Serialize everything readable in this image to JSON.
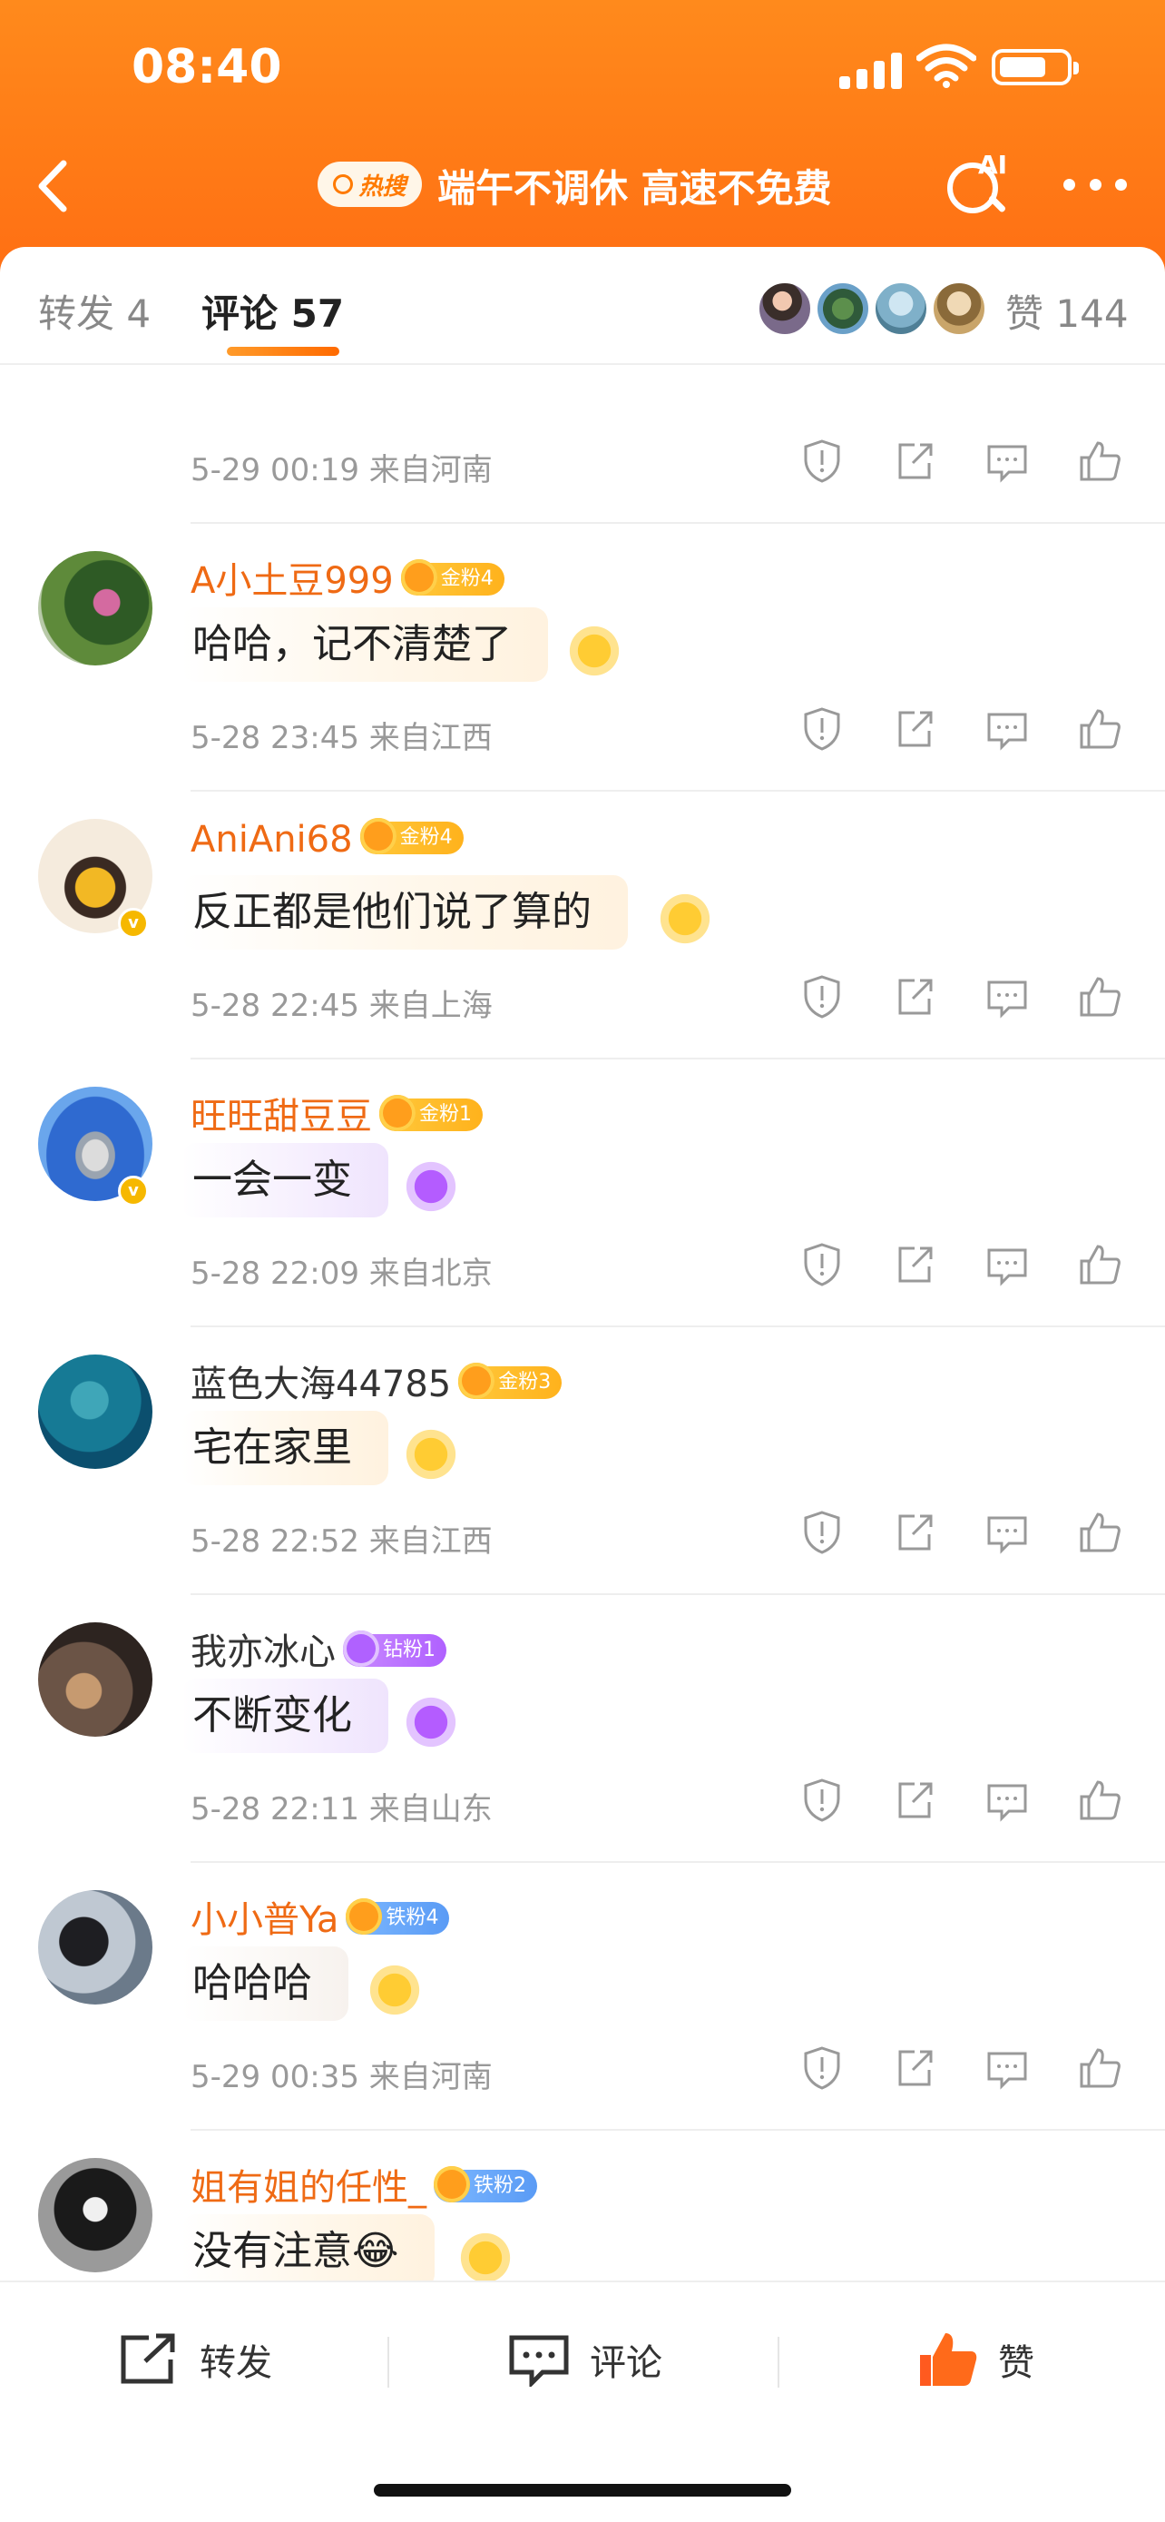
{
  "status_bar": {
    "time": "08:40"
  },
  "nav": {
    "hot_badge": "热搜",
    "title": "端午不调休 高速不免费",
    "ai_label": "AI"
  },
  "tabs": {
    "repost": "转发 4",
    "comments": "评论 57",
    "likes_prefix": "赞",
    "likes_count": "144"
  },
  "comments": [
    {
      "user": "",
      "badge": "",
      "text": "",
      "meta": "5-29 00:19  来自河南"
    },
    {
      "user": "A小土豆999",
      "badge": "金粉4",
      "text": "哈哈，记不清楚了",
      "meta": "5-28 23:45  来自江西"
    },
    {
      "user": "AniAni68",
      "badge": "金粉4",
      "text": "反正都是他们说了算的",
      "meta": "5-28 22:45  来自上海"
    },
    {
      "user": "旺旺甜豆豆",
      "badge": "金粉1",
      "text": "一会一变",
      "meta": "5-28 22:09  来自北京"
    },
    {
      "user": "蓝色大海44785",
      "badge": "金粉3",
      "text": "宅在家里",
      "meta": "5-28 22:52  来自江西"
    },
    {
      "user": "我亦冰心",
      "badge": "钻粉1",
      "text": "不断变化",
      "meta": "5-28 22:11  来自山东"
    },
    {
      "user": "小小普Ya",
      "badge": "铁粉4",
      "text": "哈哈哈",
      "meta": "5-29 00:35  来自河南"
    },
    {
      "user": "姐有姐的任性_",
      "badge": "铁粉2",
      "text": "没有注意😂",
      "meta": ""
    }
  ],
  "bottom_bar": {
    "repost": "转发",
    "comment": "评论",
    "like": "赞"
  },
  "colors": {
    "brand_orange": "#ff7a16",
    "username_orange": "#ef6a14",
    "meta_gray": "#999999"
  }
}
